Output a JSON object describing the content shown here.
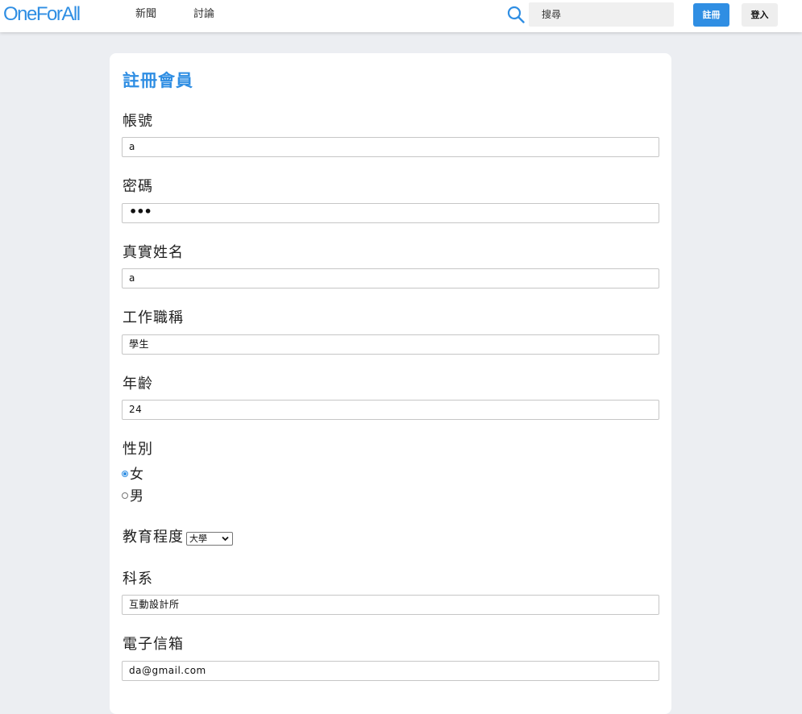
{
  "header": {
    "logo": "OneForAll",
    "nav": [
      "新聞",
      "討論"
    ],
    "search_placeholder": "搜尋",
    "register_label": "註冊",
    "login_label": "登入"
  },
  "form": {
    "title": "註冊會員",
    "username": {
      "label": "帳號",
      "value": "a"
    },
    "password": {
      "label": "密碼",
      "value": "•••"
    },
    "realname": {
      "label": "真實姓名",
      "value": "a"
    },
    "job_title": {
      "label": "工作職稱",
      "value": "學生"
    },
    "age": {
      "label": "年齡",
      "value": "24"
    },
    "gender": {
      "label": "性別",
      "options": [
        {
          "label": "女",
          "checked": true
        },
        {
          "label": "男",
          "checked": false
        }
      ]
    },
    "education": {
      "label": "教育程度",
      "selected": "大學"
    },
    "department": {
      "label": "科系",
      "value": "互動設計所"
    },
    "email": {
      "label": "電子信箱",
      "value": "da@gmail.com"
    }
  },
  "colors": {
    "accent": "#2f8ee3",
    "page_background": "#eceef2",
    "card_background": "#ffffff"
  },
  "icons": {
    "search": "search-icon",
    "dropdown": "chevron-down-icon"
  }
}
